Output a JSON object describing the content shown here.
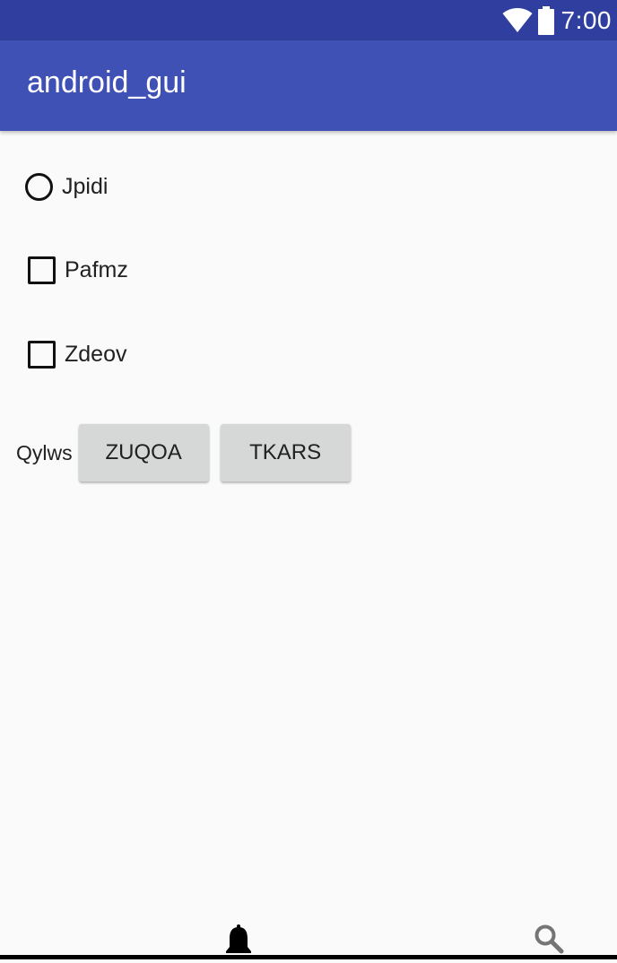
{
  "status_bar": {
    "time": "7:00",
    "icons": [
      "wifi-icon",
      "battery-icon"
    ],
    "color": "#303f9f"
  },
  "app_bar": {
    "title": "android_gui",
    "color": "#3f51b5"
  },
  "options": [
    {
      "type": "radio",
      "label": "Jpidi",
      "checked": false
    },
    {
      "type": "checkbox",
      "label": "Pafmz",
      "checked": false
    },
    {
      "type": "checkbox",
      "label": "Zdeov",
      "checked": false
    }
  ],
  "button_group": {
    "label": "Qylws",
    "buttons": [
      "ZUQOA",
      "TKARS"
    ]
  },
  "bottom_bar": {
    "icons": [
      "bell-icon",
      "search-icon"
    ]
  }
}
